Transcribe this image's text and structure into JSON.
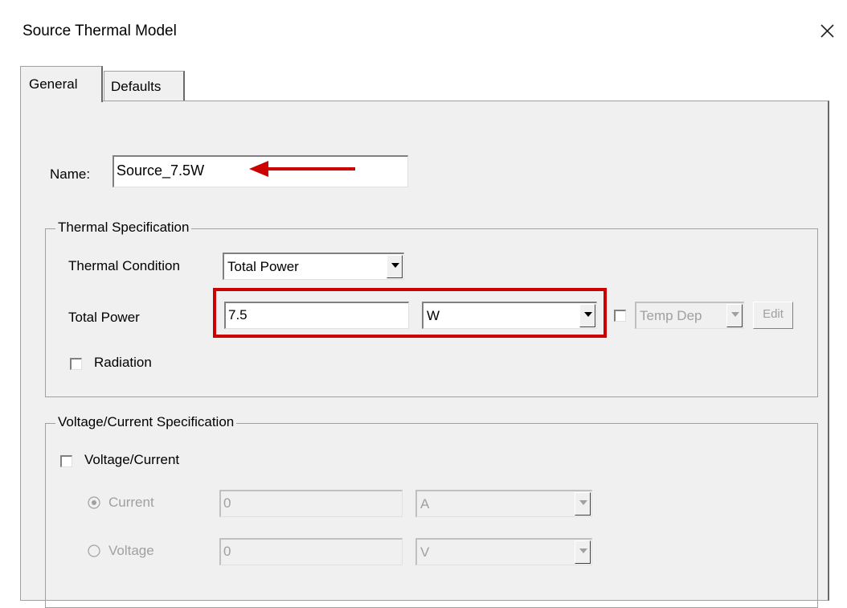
{
  "window": {
    "title": "Source Thermal Model"
  },
  "tabs": [
    {
      "label": "General"
    },
    {
      "label": "Defaults"
    }
  ],
  "name_field": {
    "label": "Name:",
    "value": "Source_7.5W"
  },
  "thermal_spec": {
    "legend": "Thermal Specification",
    "condition_label": "Thermal Condition",
    "condition_value": "Total Power",
    "power_label": "Total Power",
    "power_value": "7.5",
    "power_unit": "W",
    "temp_dep_value": "Temp Dep",
    "edit_label": "Edit",
    "radiation_label": "Radiation"
  },
  "vc_spec": {
    "legend": "Voltage/Current Specification",
    "checkbox_label": "Voltage/Current",
    "current_label": "Current",
    "current_value": "0",
    "current_unit": "A",
    "voltage_label": "Voltage",
    "voltage_value": "0",
    "voltage_unit": "V"
  },
  "annotation_colors": {
    "highlight": "#cc0000",
    "arrow": "#cc0000"
  },
  "icons": {
    "close": "close-icon",
    "arrow": "arrow-left-icon",
    "dropdown": "chevron-down-icon"
  }
}
